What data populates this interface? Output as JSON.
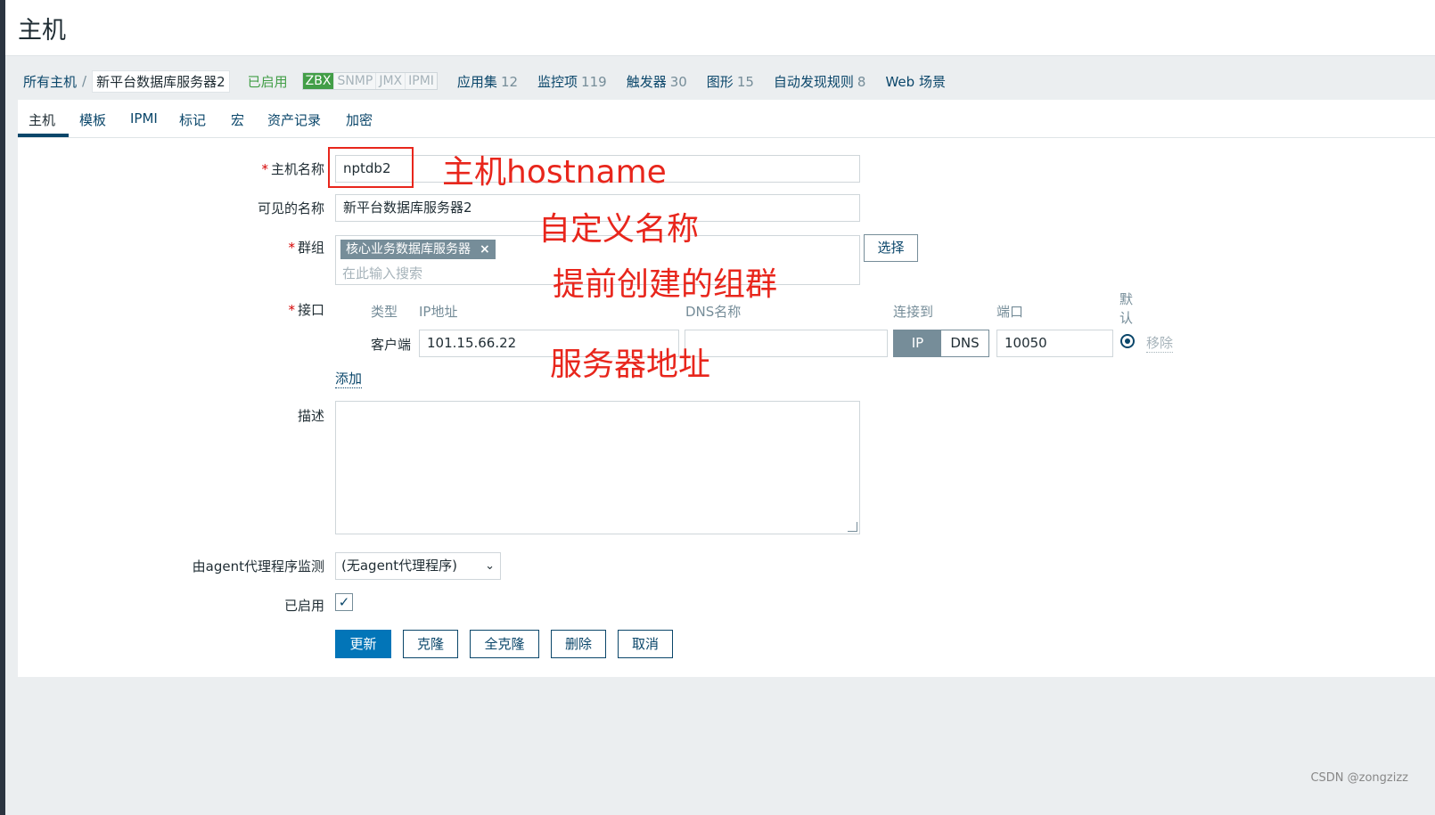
{
  "header": {
    "title": "主机"
  },
  "breadcrumb": {
    "all_hosts": "所有主机",
    "separator": "/",
    "current_host": "新平台数据库服务器2",
    "status": "已启用",
    "availability": [
      "ZBX",
      "SNMP",
      "JMX",
      "IPMI"
    ],
    "items": [
      {
        "label": "应用集",
        "count": "12"
      },
      {
        "label": "监控项",
        "count": "119"
      },
      {
        "label": "触发器",
        "count": "30"
      },
      {
        "label": "图形",
        "count": "15"
      },
      {
        "label": "自动发现规则",
        "count": "8"
      },
      {
        "label": "Web 场景",
        "count": ""
      }
    ]
  },
  "tabs": [
    "主机",
    "模板",
    "IPMI",
    "标记",
    "宏",
    "资产记录",
    "加密"
  ],
  "form": {
    "host_name": {
      "label": "主机名称",
      "value": "nptdb2"
    },
    "visible_name": {
      "label": "可见的名称",
      "value": "新平台数据库服务器2"
    },
    "groups": {
      "label": "群组",
      "selected": "核心业务数据库服务器",
      "remove_glyph": "×",
      "placeholder": "在此输入搜索",
      "select_button": "选择"
    },
    "interfaces": {
      "label": "接口",
      "headers": {
        "type": "类型",
        "ip": "IP地址",
        "dns": "DNS名称",
        "connect": "连接到",
        "port": "端口",
        "default_a": "默",
        "default_b": "认"
      },
      "row": {
        "type": "客户端",
        "ip": "101.15.66.22",
        "dns": "",
        "connect_ip": "IP",
        "connect_dns": "DNS",
        "port": "10050",
        "remove": "移除"
      },
      "add": "添加"
    },
    "description": {
      "label": "描述"
    },
    "proxy": {
      "label": "由agent代理程序监测",
      "value": "(无agent代理程序)",
      "arrow": "⌄"
    },
    "enabled": {
      "label": "已启用",
      "check": "✓"
    },
    "required_mark": "*"
  },
  "buttons": {
    "update": "更新",
    "clone": "克隆",
    "full_clone": "全克隆",
    "delete": "删除",
    "cancel": "取消"
  },
  "annotations": {
    "hostname": "主机hostname",
    "visible": "自定义名称",
    "group": "提前创建的组群",
    "address": "服务器地址",
    "color": "#e8261c"
  },
  "watermark": "CSDN @zongzizz",
  "colors": {
    "link": "#0a466a",
    "enabled": "#429e47",
    "primary": "#0275b8",
    "required": "#d40000"
  }
}
